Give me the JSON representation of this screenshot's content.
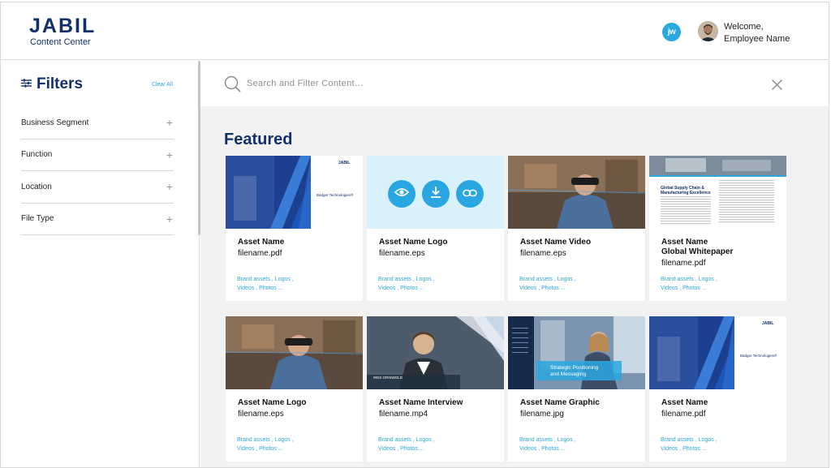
{
  "header": {
    "logo_text": "JABIL",
    "logo_subtitle": "Content Center",
    "user_initials": "jw",
    "welcome_line1": "Welcome,",
    "welcome_line2": "Employee Name"
  },
  "sidebar": {
    "title": "Filters",
    "clear_all": "Clear All",
    "filters": [
      {
        "label": "Business Segment"
      },
      {
        "label": "Function"
      },
      {
        "label": "Location"
      },
      {
        "label": "File Type"
      }
    ]
  },
  "search": {
    "placeholder": "Search and Filter Content…"
  },
  "featured_title": "Featured",
  "cards": [
    {
      "title": "Asset Name",
      "title2": "",
      "file": "filename.pdf",
      "tags1": "Brand assets , Logos ,",
      "tags2": "Videos , Photos ...",
      "thumb_text1": "JABIL",
      "thumb_text2": "Badger Technologies®"
    },
    {
      "title": "Asset Name Logo",
      "title2": "",
      "file": "filename.eps",
      "tags1": "Brand assets , Logos ,",
      "tags2": "Videos , Photos ..."
    },
    {
      "title": "Asset Name Video",
      "title2": "",
      "file": "filename.eps",
      "tags1": "Brand assets , Logos ,",
      "tags2": "Videos , Photos ..."
    },
    {
      "title": "Asset Name",
      "title2": "Global Whitepaper",
      "file": "filename.pdf",
      "tags1": "Brand assets , Logos ,",
      "tags2": "Videos , Photos ...",
      "thumb_text1": "Global Supply Chain & Manufacturing Excellence"
    },
    {
      "title": "Asset Name Logo",
      "title2": "",
      "file": "filename.eps",
      "tags1": "Brand assets , Logos ,",
      "tags2": "Videos , Photos ..."
    },
    {
      "title": "Asset Name Interview",
      "title2": "",
      "file": "filename.mp4",
      "tags1": "Brand assets , Logos ,",
      "tags2": "Videos , Photos ...",
      "thumb_text1": "WES GRISWOLD"
    },
    {
      "title": "Asset Name Graphic",
      "title2": "",
      "file": "filename.jpg",
      "tags1": "Brand assets , Logos ,",
      "tags2": "Videos , Photos ...",
      "thumb_text1": "Strategic Positioning",
      "thumb_text2": "and Messaging"
    },
    {
      "title": "Asset Name",
      "title2": "",
      "file": "filename.pdf",
      "tags1": "Brand assets , Logos ,",
      "tags2": "Videos , Photos ...",
      "thumb_text1": "JABIL",
      "thumb_text2": "Badger Technologies®"
    }
  ],
  "colors": {
    "brand_navy": "#13306b",
    "accent_blue": "#2aa7e0",
    "link_blue": "#2ea8e0"
  },
  "icons": [
    "filter-sliders-icon",
    "search-icon",
    "close-icon",
    "eye-icon",
    "download-icon",
    "link-icon",
    "plus-icon"
  ]
}
